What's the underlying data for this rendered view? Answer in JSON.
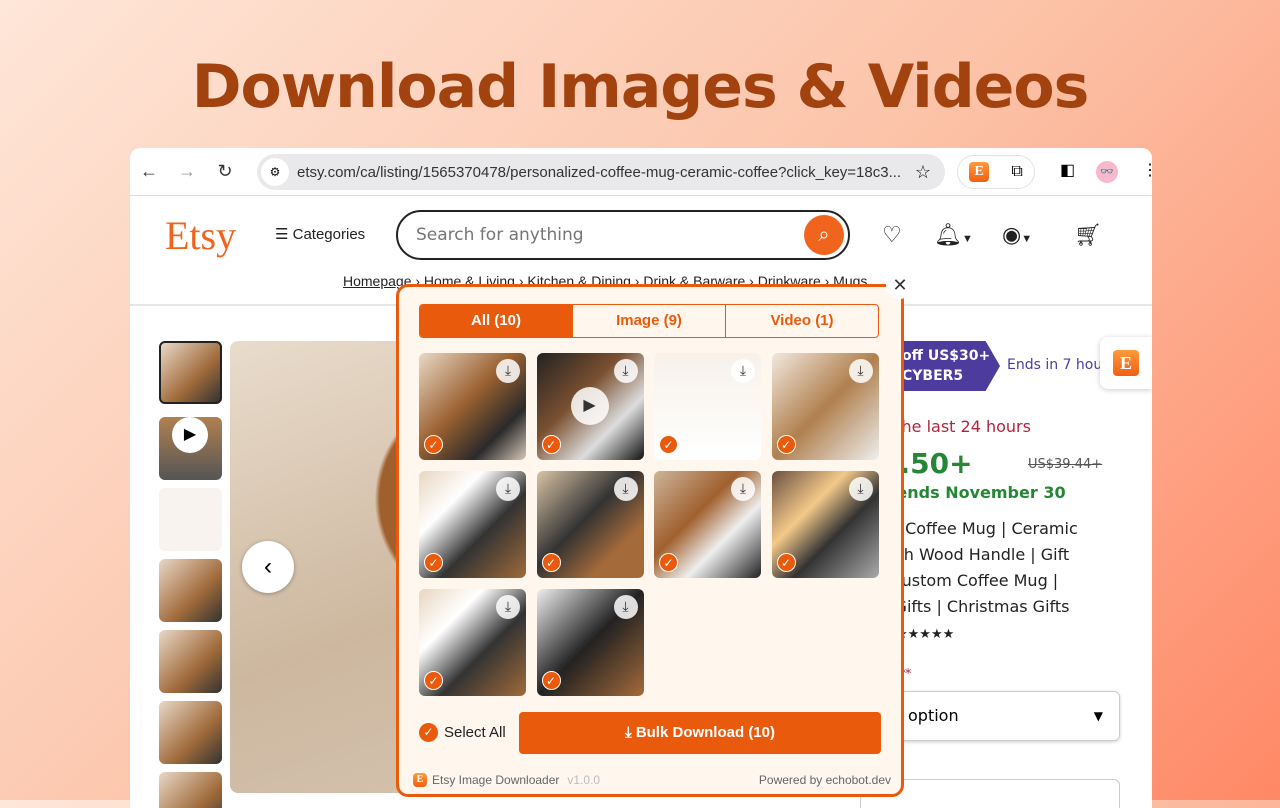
{
  "hero_title": "Download Images & Videos",
  "browser": {
    "url": "etsy.com/ca/listing/1565370478/personalized-coffee-mug-ceramic-coffee?click_key=18c3...",
    "ext_letter": "E"
  },
  "etsy": {
    "logo": "Etsy",
    "categories": "Categories",
    "search_placeholder": "Search for anything",
    "breadcrumb": "Homepage › Home & Living › Kitchen & Dining › Drink & Barware › Drinkware › Mugs"
  },
  "listing": {
    "promo_line1": "off US$30+",
    "promo_line2": "CYBER5",
    "ends": "Ends in 7 hour",
    "sold": "n the last 24 hours",
    "price": "5.50+",
    "old_price": "US$39.44+",
    "sale_ends": "e ends November 30",
    "title_lines": [
      "ed Coffee Mug | Ceramic",
      "with Wood Handle | Gift",
      "| Custom Coffee Mug |",
      "y Gifts | Christmas Gifts"
    ],
    "reviews": "ts ★★★★★",
    "color_label": "olor",
    "color_select": "option",
    "option_label": "n"
  },
  "popup": {
    "tabs": [
      {
        "label": "All (10)",
        "active": true
      },
      {
        "label": "Image (9)"
      },
      {
        "label": "Video (1)"
      }
    ],
    "items": [
      {
        "type": "image"
      },
      {
        "type": "video"
      },
      {
        "type": "image"
      },
      {
        "type": "image"
      },
      {
        "type": "image"
      },
      {
        "type": "image"
      },
      {
        "type": "image"
      },
      {
        "type": "image"
      },
      {
        "type": "image"
      },
      {
        "type": "image"
      }
    ],
    "select_all": "Select All",
    "bulk_download": "Bulk Download (10)",
    "app_name": "Etsy Image Downloader",
    "version": "v1.0.0",
    "powered_by": "Powered by echobot.dev"
  },
  "colors": {
    "accent": "#ea5a0c",
    "etsy_orange": "#f1641e",
    "promo": "#4d3b9e",
    "sale_green": "#258635",
    "sold_red": "#b3243b"
  }
}
